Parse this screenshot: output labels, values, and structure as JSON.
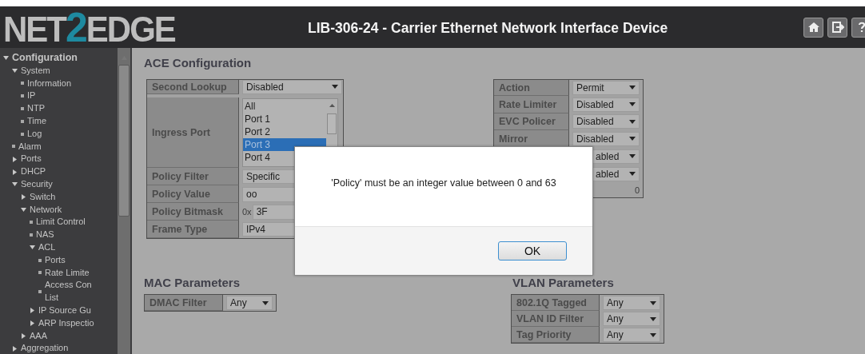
{
  "header": {
    "logo": [
      "NET",
      "2",
      "EDGE"
    ],
    "title": "LIB-306-24 - Carrier Ethernet Network Interface Device"
  },
  "sidebar": {
    "items": [
      {
        "kind": "group",
        "label": "Configuration",
        "expanded": true,
        "children": [
          {
            "kind": "group",
            "label": "System",
            "expanded": true,
            "children": [
              {
                "kind": "page",
                "label": "Information"
              },
              {
                "kind": "page",
                "label": "IP"
              },
              {
                "kind": "page",
                "label": "NTP"
              },
              {
                "kind": "page",
                "label": "Time"
              },
              {
                "kind": "page",
                "label": "Log"
              }
            ]
          },
          {
            "kind": "page",
            "label": "Alarm"
          },
          {
            "kind": "group",
            "label": "Ports",
            "expanded": false
          },
          {
            "kind": "group",
            "label": "DHCP",
            "expanded": false
          },
          {
            "kind": "group",
            "label": "Security",
            "expanded": true,
            "children": [
              {
                "kind": "group",
                "label": "Switch",
                "expanded": false
              },
              {
                "kind": "group",
                "label": "Network",
                "expanded": true,
                "children": [
                  {
                    "kind": "page",
                    "label": "Limit Control"
                  },
                  {
                    "kind": "page",
                    "label": "NAS"
                  },
                  {
                    "kind": "group",
                    "label": "ACL",
                    "expanded": true,
                    "children": [
                      {
                        "kind": "page",
                        "label": "Ports"
                      },
                      {
                        "kind": "page",
                        "label": "Rate Limite"
                      },
                      {
                        "kind": "page",
                        "label": "Access Con\nList"
                      }
                    ]
                  },
                  {
                    "kind": "group",
                    "label": "IP Source Gu",
                    "expanded": false
                  },
                  {
                    "kind": "group",
                    "label": "ARP Inspectio",
                    "expanded": false
                  }
                ]
              },
              {
                "kind": "group",
                "label": "AAA",
                "expanded": false
              }
            ]
          },
          {
            "kind": "group",
            "label": "Aggregation",
            "expanded": false
          }
        ]
      }
    ]
  },
  "ace": {
    "title": "ACE Configuration",
    "left": [
      {
        "kind": "select",
        "label": "Second Lookup",
        "value": "Disabled"
      },
      {
        "kind": "listbox",
        "label": "Ingress Port",
        "options": [
          {
            "label": "All",
            "selected": false
          },
          {
            "label": "Port 1",
            "selected": false
          },
          {
            "label": "Port 2",
            "selected": false
          },
          {
            "label": "Port 3",
            "selected": true
          },
          {
            "label": "Port 4",
            "selected": false
          }
        ]
      },
      {
        "kind": "select",
        "label": "Policy Filter",
        "value": "Specific"
      },
      {
        "kind": "input",
        "label": "Policy Value",
        "value": "oo"
      },
      {
        "kind": "hex",
        "label": "Policy Bitmask",
        "prefix": "0x",
        "value": "3F"
      },
      {
        "kind": "select",
        "label": "Frame Type",
        "value": "IPv4"
      }
    ],
    "right": [
      {
        "kind": "select",
        "label": "Action",
        "value": "Permit"
      },
      {
        "kind": "select",
        "label": "Rate Limiter",
        "value": "Disabled"
      },
      {
        "kind": "select",
        "label": "EVC Policer",
        "value": "Disabled"
      },
      {
        "kind": "select",
        "label": "Mirror",
        "value": "Disabled"
      },
      {
        "kind": "select",
        "value": "abled"
      },
      {
        "kind": "select",
        "value": "abled"
      },
      {
        "kind": "counter",
        "value": "0"
      }
    ]
  },
  "mac": {
    "title": "MAC Parameters",
    "rows": [
      {
        "label": "DMAC Filter",
        "value": "Any"
      }
    ]
  },
  "vlan": {
    "title": "VLAN Parameters",
    "rows": [
      {
        "label": "802.1Q Tagged",
        "value": "Any"
      },
      {
        "label": "VLAN ID Filter",
        "value": "Any"
      },
      {
        "label": "Tag Priority",
        "value": "Any"
      }
    ]
  },
  "dialog": {
    "message": "'Policy' must be an integer value between 0 and 63",
    "button": "OK"
  }
}
